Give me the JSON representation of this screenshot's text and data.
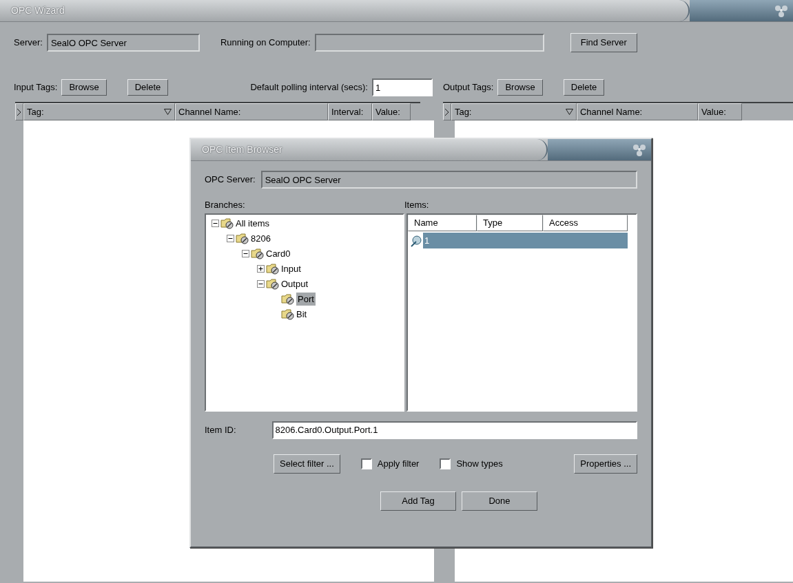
{
  "window": {
    "title": "OPC Wizard"
  },
  "server": {
    "label": "Server:",
    "value": "SealO OPC Server",
    "computer_label": "Running on Computer:",
    "find_button": "Find Server"
  },
  "input_tags": {
    "label": "Input Tags:",
    "browse": "Browse",
    "delete": "Delete",
    "interval_label": "Default polling interval (secs):",
    "interval_value": "1",
    "columns": [
      {
        "label": "Tag:",
        "sort": true
      },
      {
        "label": "Channel Name:",
        "sort": false
      },
      {
        "label": "Interval:",
        "sort": false
      },
      {
        "label": "Value:",
        "sort": false
      }
    ]
  },
  "output_tags": {
    "label": "Output Tags:",
    "browse": "Browse",
    "delete": "Delete",
    "columns": [
      {
        "label": "Tag:",
        "sort": true
      },
      {
        "label": "Channel Name:",
        "sort": false
      },
      {
        "label": "Value:",
        "sort": false
      }
    ]
  },
  "dialog": {
    "title": "OPC Item Browser",
    "server_label": "OPC Server:",
    "server_value": "SealO OPC Server",
    "branches_label": "Branches:",
    "items_label": "Items:",
    "tree": [
      {
        "label": "All items",
        "expanded": true,
        "selected": false,
        "children": [
          {
            "label": "8206",
            "expanded": true,
            "selected": false,
            "children": [
              {
                "label": "Card0",
                "expanded": true,
                "selected": false,
                "children": [
                  {
                    "label": "Input",
                    "expanded": false,
                    "selected": false
                  },
                  {
                    "label": "Output",
                    "expanded": true,
                    "selected": false,
                    "children": [
                      {
                        "label": "Port",
                        "selected": true
                      },
                      {
                        "label": "Bit",
                        "selected": false
                      }
                    ]
                  }
                ]
              }
            ]
          }
        ]
      }
    ],
    "item_columns": [
      "Name",
      "Type",
      "Access"
    ],
    "items": [
      {
        "name": "1",
        "selected": true
      }
    ],
    "item_id_label": "Item ID:",
    "item_id_value": "8206.Card0.Output.Port.1",
    "select_filter": "Select filter ...",
    "apply_filter": {
      "label": "Apply filter",
      "checked": false
    },
    "show_types": {
      "label": "Show types",
      "checked": false
    },
    "properties": "Properties ...",
    "add_tag": "Add Tag",
    "done": "Done"
  }
}
